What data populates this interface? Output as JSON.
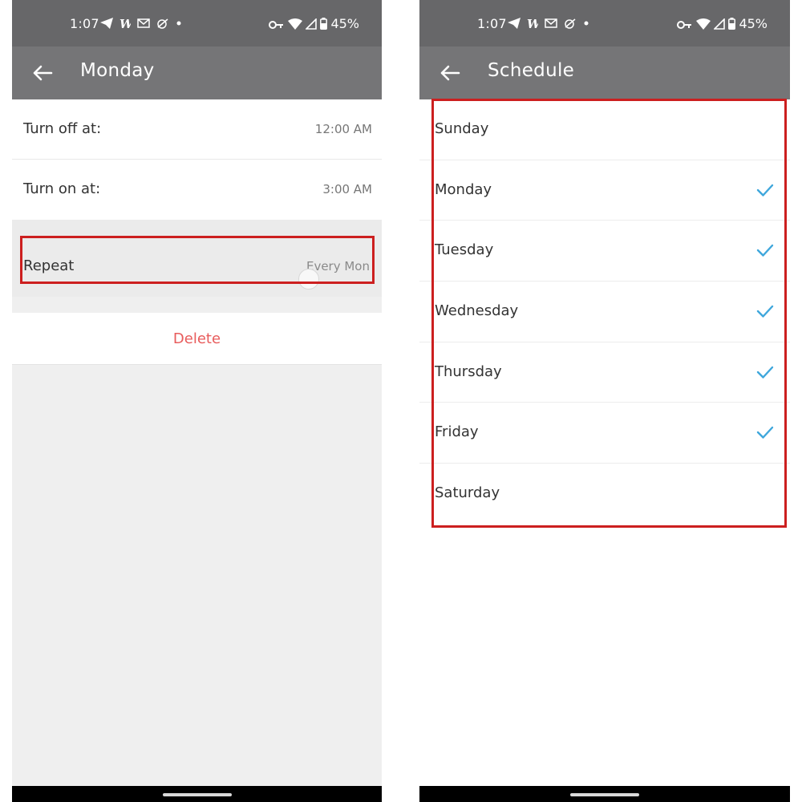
{
  "status_bar": {
    "time": "1:07",
    "battery": "45%"
  },
  "left_screen": {
    "title": "Monday",
    "turn_off": {
      "label": "Turn off at:",
      "value": "12:00 AM"
    },
    "turn_on": {
      "label": "Turn on at:",
      "value": "3:00 AM"
    },
    "repeat": {
      "label": "Repeat",
      "value": "Every Mon"
    },
    "delete_label": "Delete"
  },
  "right_screen": {
    "title": "Schedule",
    "days": [
      {
        "label": "Sunday",
        "checked": false
      },
      {
        "label": "Monday",
        "checked": true
      },
      {
        "label": "Tuesday",
        "checked": true
      },
      {
        "label": "Wednesday",
        "checked": true
      },
      {
        "label": "Thursday",
        "checked": true
      },
      {
        "label": "Friday",
        "checked": true
      },
      {
        "label": "Saturday",
        "checked": false
      }
    ]
  },
  "colors": {
    "status_bar": "#676769",
    "app_bar": "#757577",
    "delete": "#e85c5c",
    "check": "#3fa7dc",
    "highlight": "#cc1f1f"
  }
}
